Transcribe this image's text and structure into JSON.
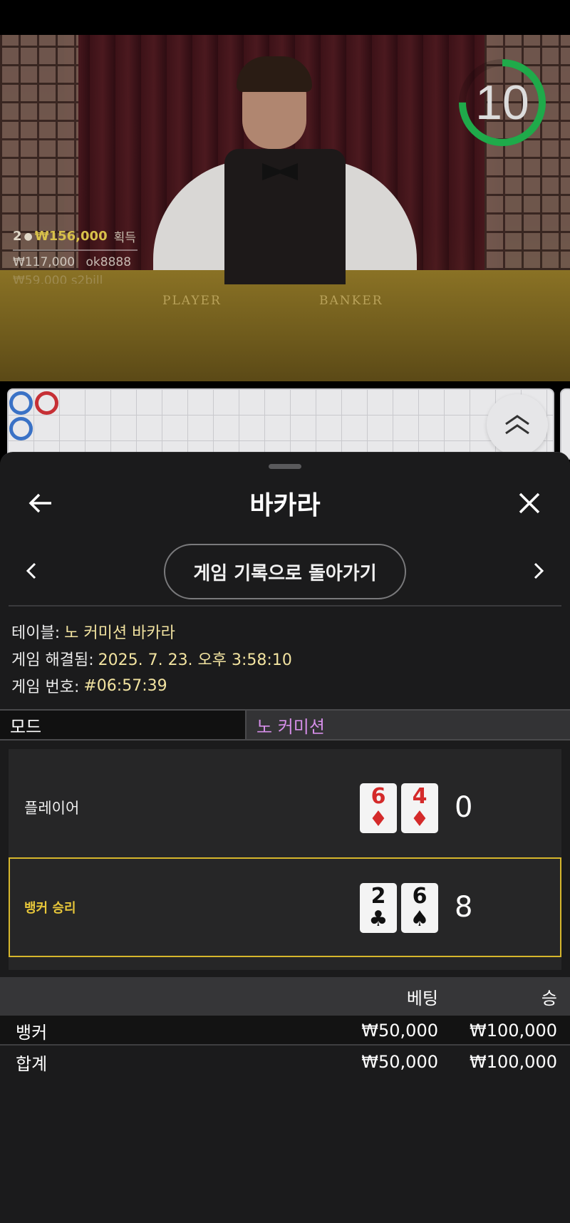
{
  "video": {
    "winner_count": "2",
    "winner_amount": "₩156,000",
    "winner_suffix": "획득",
    "second_amount": "₩117,000",
    "second_user": "ok8888",
    "third_amount": "₩59,000",
    "third_user": "s2bill",
    "felt_player": "PLAYER",
    "felt_banker": "BANKER",
    "countdown": "10",
    "countdown_fraction": 0.75
  },
  "roadmap": {
    "cells": [
      {
        "col": 0,
        "row": 0,
        "result": "player"
      },
      {
        "col": 0,
        "row": 1,
        "result": "player"
      },
      {
        "col": 1,
        "row": 0,
        "result": "banker"
      }
    ],
    "collapse_icon": "chevrons-up-icon"
  },
  "sheet": {
    "title": "바카라",
    "back_icon": "arrow-left-icon",
    "close_icon": "close-icon",
    "back_to_history": "게임 기록으로 돌아가기",
    "prev_icon": "chevron-left-icon",
    "next_icon": "chevron-right-icon"
  },
  "info": {
    "table_label": "테이블:",
    "table_value": "노 커미션 바카라",
    "resolved_label": "게임 해결됨:",
    "resolved_value": "2025. 7. 23. 오후 3:58:10",
    "number_label": "게임 번호:",
    "number_value": "#06:57:39"
  },
  "mode": {
    "label": "모드",
    "value": "노 커미션"
  },
  "hands": {
    "player": {
      "label": "플레이어",
      "cards": [
        {
          "rank": "6",
          "suit": "♦",
          "color": "red"
        },
        {
          "rank": "4",
          "suit": "♦",
          "color": "red"
        }
      ],
      "score": "0"
    },
    "banker": {
      "label": "뱅커 승리",
      "cards": [
        {
          "rank": "2",
          "suit": "♣",
          "color": "black"
        },
        {
          "rank": "6",
          "suit": "♠",
          "color": "black"
        }
      ],
      "score": "8"
    }
  },
  "bets": {
    "col_bet": "베팅",
    "col_win": "승",
    "rows": [
      {
        "name": "뱅커",
        "bet": "₩50,000",
        "win": "₩100,000"
      },
      {
        "name": "합계",
        "bet": "₩50,000",
        "win": "₩100,000"
      }
    ]
  },
  "colors": {
    "accent_gold": "#e8c73a",
    "mode_value": "#d58ee8",
    "info_value": "#f2e3a0",
    "timer_green": "#1faa4a",
    "player_blue": "#3a72c6",
    "banker_red": "#c62f35"
  }
}
